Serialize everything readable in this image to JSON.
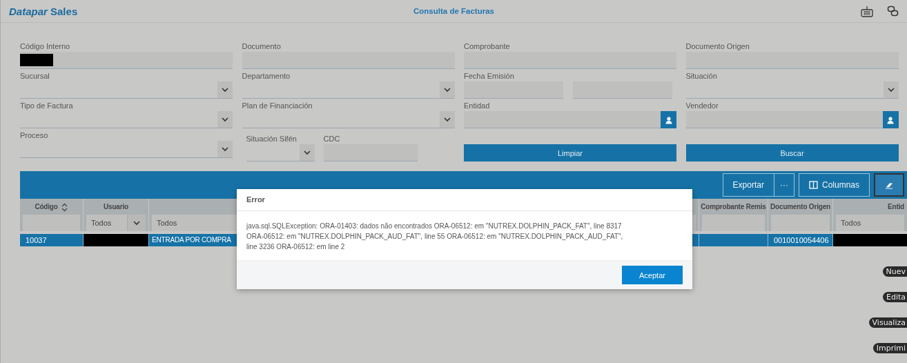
{
  "header": {
    "brand": "*Datapar* Sales",
    "title": "Consulta de Facturas"
  },
  "form": {
    "fields": [
      {
        "label": "Código Interno",
        "kind": "text",
        "redacted": true
      },
      {
        "label": "Documento",
        "kind": "text"
      },
      {
        "label": "Comprobante",
        "kind": "text"
      },
      {
        "label": "Documento Origen",
        "kind": "text"
      },
      {
        "label": "Sucursal",
        "kind": "select"
      },
      {
        "label": "Departamento",
        "kind": "select"
      },
      {
        "label": "Fecha Emisión",
        "kind": "date_range"
      },
      {
        "label": "Situación",
        "kind": "select"
      },
      {
        "label": "Tipo de Factura",
        "kind": "select"
      },
      {
        "label": "Plan de Financiación",
        "kind": "select"
      },
      {
        "label": "Entidad",
        "kind": "lookup"
      },
      {
        "label": "Vendedor",
        "kind": "lookup"
      },
      {
        "label": "Proceso",
        "kind": "select"
      },
      {
        "kind": "pair",
        "items": [
          {
            "label": "Situación Sifén",
            "kind": "select"
          },
          {
            "label": "CDC",
            "kind": "text"
          }
        ]
      },
      {
        "kind": "button",
        "label": "Limpiar"
      },
      {
        "kind": "button",
        "label": "Buscar"
      }
    ]
  },
  "grid": {
    "toolbar": [
      {
        "kind": "button",
        "label": "Exportar"
      },
      {
        "kind": "more",
        "label": "···"
      },
      {
        "kind": "columns",
        "label": "Columnas"
      },
      {
        "kind": "eraser"
      }
    ],
    "columns": [
      {
        "label": "Código",
        "sortable": true,
        "filter": {
          "kind": "text"
        }
      },
      {
        "label": "Usuario",
        "filter": {
          "kind": "select",
          "value": "Todos"
        }
      },
      {
        "filter": {
          "kind": "text",
          "value": "Todos"
        }
      },
      {
        "label": "Comprobante Remis",
        "filter": {
          "kind": "text"
        }
      },
      {
        "label": "Documento Origen",
        "filter": {
          "kind": "text"
        }
      },
      {
        "label": "Entid",
        "filter": {
          "kind": "text",
          "value": "Todos"
        }
      }
    ],
    "rows": [
      {
        "selected": true,
        "cells": [
          {
            "text": "10037"
          },
          {
            "redacted": true
          },
          {
            "text": "ENTRADA POR COMPRA"
          },
          {},
          {
            "text": "0010010054406"
          },
          {
            "redacted": true
          }
        ]
      }
    ]
  },
  "dialog": {
    "title": "Error",
    "message": "java.sql.SQLException: ORA-01403: dados não encontrados ORA-06512: em \"NUTREX.DOLPHIN_PACK_FAT\", line 8317 ORA-06512: em \"NUTREX.DOLPHIN_PACK_AUD_FAT\", line 55 ORA-06512: em \"NUTREX.DOLPHIN_PACK_AUD_FAT\", line 3236 ORA-06512: em line 2",
    "button": "Aceptar"
  },
  "actions": [
    "Nuev",
    "Edita",
    "Visualiza",
    "Imprimi"
  ]
}
